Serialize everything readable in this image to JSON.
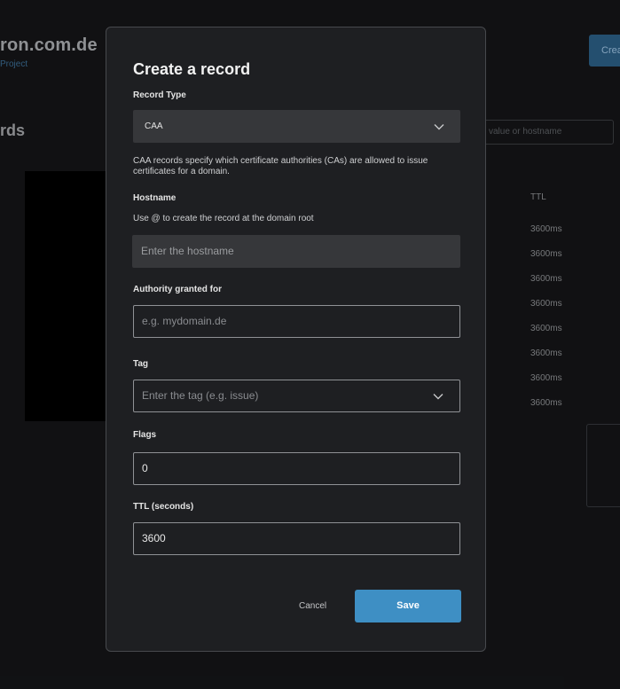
{
  "background": {
    "domain_title": "ron.com.de",
    "project_link": "Project",
    "section_title": "rds",
    "create_button": "Crea",
    "search_placeholder": "value or hostname",
    "ttl_header": "TTL",
    "ttl_values": [
      "3600ms",
      "3600ms",
      "3600ms",
      "3600ms",
      "3600ms",
      "3600ms",
      "3600ms",
      "3600ms"
    ]
  },
  "modal": {
    "title": "Create a record",
    "record_type": {
      "label": "Record Type",
      "value": "CAA",
      "help": "CAA records specify which certificate authorities (CAs) are allowed to issue certificates for a domain."
    },
    "hostname": {
      "label": "Hostname",
      "help": "Use @ to create the record at the domain root",
      "placeholder": "Enter the hostname"
    },
    "authority": {
      "label": "Authority granted for",
      "placeholder": "e.g. mydomain.de"
    },
    "tag": {
      "label": "Tag",
      "placeholder": "Enter the tag (e.g. issue)"
    },
    "flags": {
      "label": "Flags",
      "value": "0"
    },
    "ttl": {
      "label": "TTL (seconds)",
      "value": "3600"
    },
    "cancel_label": "Cancel",
    "save_label": "Save"
  },
  "colors": {
    "accent": "#3e8fc4",
    "modal_bg": "#1e1f22",
    "page_bg": "#141517"
  }
}
